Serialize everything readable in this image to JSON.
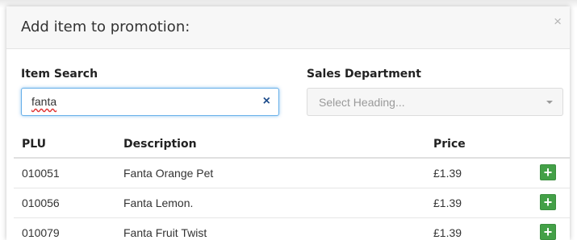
{
  "modal": {
    "title": "Add item to promotion:",
    "close_glyph": "×"
  },
  "item_search": {
    "label": "Item Search",
    "value": "fanta",
    "clear_glyph": "×"
  },
  "sales_department": {
    "label": "Sales Department",
    "placeholder": "Select Heading..."
  },
  "table": {
    "headers": {
      "plu": "PLU",
      "description": "Description",
      "price": "Price"
    },
    "rows": [
      {
        "plu": "010051",
        "description": "Fanta Orange Pet",
        "price": "£1.39",
        "add": "+"
      },
      {
        "plu": "010056",
        "description": "Fanta Lemon.",
        "price": "£1.39",
        "add": "+"
      },
      {
        "plu": "010079",
        "description": "Fanta Fruit Twist",
        "price": "£1.39",
        "add": "+"
      }
    ]
  },
  "colors": {
    "add_button": "#43a047",
    "focus_border": "#66afe9",
    "clear_icon": "#1f4e8c"
  },
  "icons": {
    "close": "close-icon",
    "clear": "clear-icon",
    "dropdown": "chevron-down-icon",
    "add": "plus-icon"
  }
}
